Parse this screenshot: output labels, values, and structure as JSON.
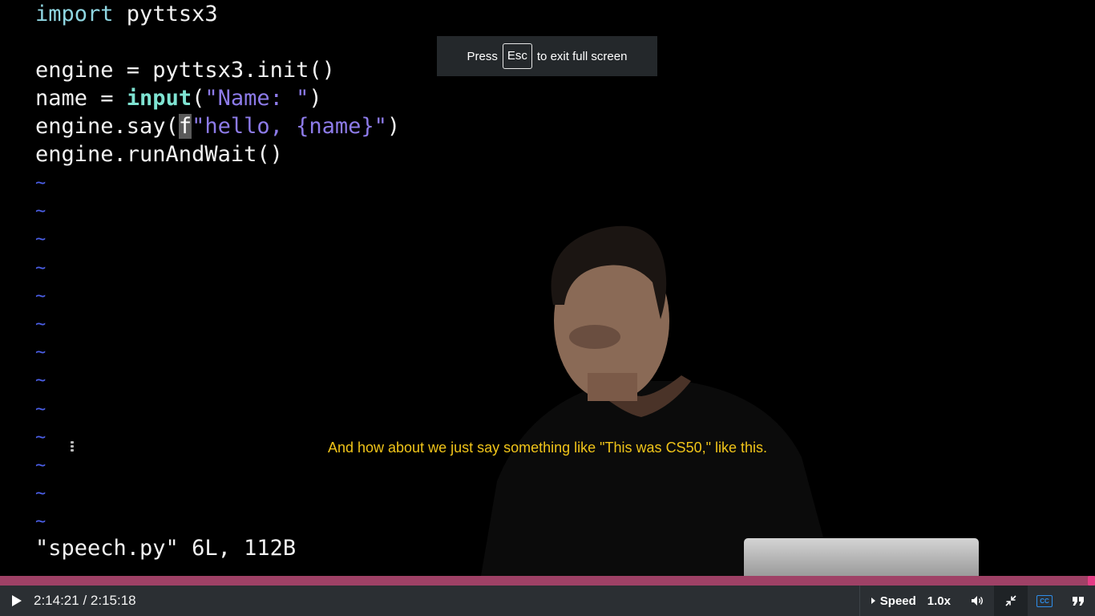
{
  "editor": {
    "lines": [
      {
        "parts": [
          {
            "text": "import",
            "cls": "kw"
          },
          {
            "text": " pyttsx3",
            "cls": ""
          }
        ]
      },
      {
        "parts": []
      },
      {
        "parts": [
          {
            "text": "engine = pyttsx3.init()",
            "cls": ""
          }
        ]
      },
      {
        "parts": [
          {
            "text": "name = ",
            "cls": ""
          },
          {
            "text": "input",
            "cls": "fn"
          },
          {
            "text": "(",
            "cls": ""
          },
          {
            "text": "\"Name: \"",
            "cls": "str"
          },
          {
            "text": ")",
            "cls": ""
          }
        ]
      },
      {
        "parts": [
          {
            "text": "engine.say(",
            "cls": ""
          },
          {
            "text": "f",
            "cls": "cursor"
          },
          {
            "text": "\"hello, {name}\"",
            "cls": "str"
          },
          {
            "text": ")",
            "cls": ""
          }
        ]
      },
      {
        "parts": [
          {
            "text": "engine.runAndWait()",
            "cls": ""
          }
        ]
      }
    ],
    "tilde_char": "~",
    "tilde_count": 13,
    "status_line": "\"speech.py\" 6L, 112B"
  },
  "toast": {
    "prefix": "Press",
    "key": "Esc",
    "suffix": "to exit full screen"
  },
  "caption": "And how about we just say something like \"This was CS50,\" like this.",
  "player": {
    "current_time": "2:14:21",
    "duration": "2:15:18",
    "time_text": "2:14:21 / 2:15:18",
    "progress_fraction": 0.993,
    "speed_label": "Speed",
    "speed_value": "1.0x",
    "icons": {
      "play": "play-icon",
      "volume": "volume-icon",
      "exit_fullscreen": "exit-fullscreen-icon",
      "captions": "cc-icon",
      "transcript": "quote-icon"
    }
  },
  "colors": {
    "progress": "#a23e63",
    "progress_handle": "#e53d86",
    "caption": "#f0c419",
    "tilde": "#4b5fe8",
    "string": "#8d7be9",
    "keyword": "#8fd6e1",
    "cc_accent": "#2f8eea"
  }
}
